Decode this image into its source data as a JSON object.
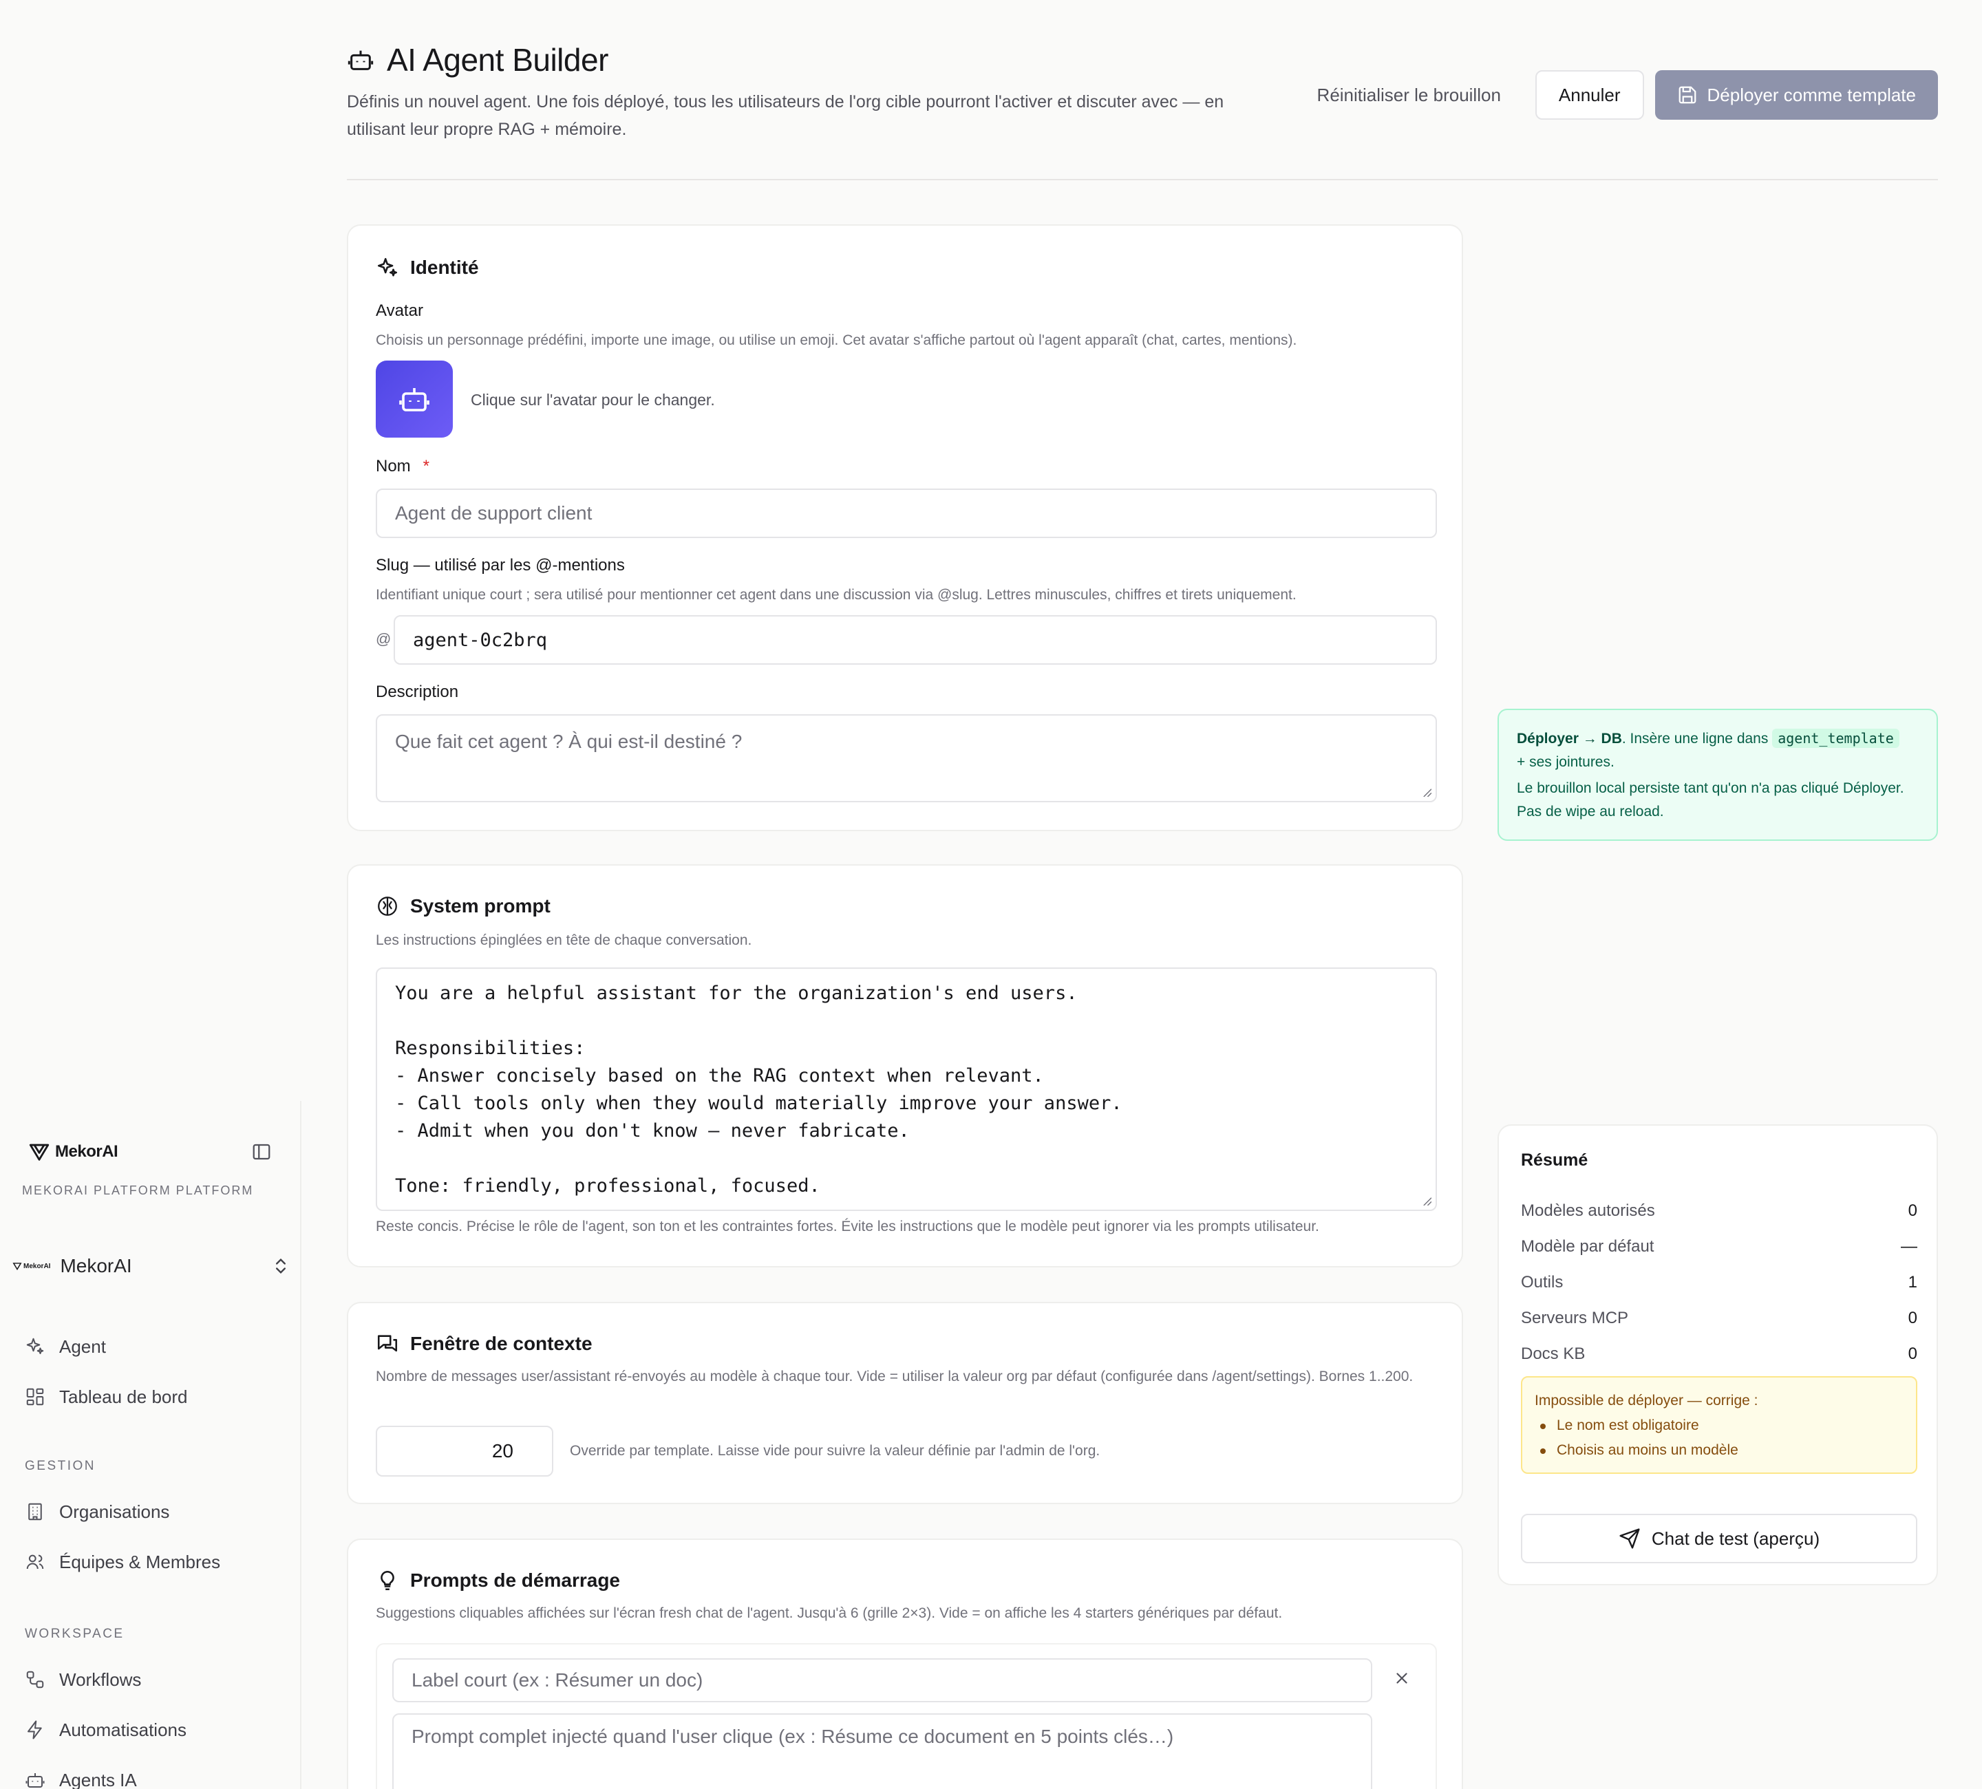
{
  "sidebar": {
    "brand": "MekorAI",
    "platform_label": "MEKORAI PLATFORM PLATFORM",
    "org_mini": "MekorAI",
    "org_name": "MekorAI",
    "nav_top": [
      {
        "label": "Agent",
        "icon": "sparkles-icon"
      },
      {
        "label": "Tableau de bord",
        "icon": "dashboard-icon"
      }
    ],
    "section_gestion": "GESTION",
    "nav_gestion": [
      {
        "label": "Organisations",
        "icon": "building-icon"
      },
      {
        "label": "Équipes & Membres",
        "icon": "users-icon"
      }
    ],
    "section_workspace": "WORKSPACE",
    "nav_workspace": [
      {
        "label": "Workflows",
        "icon": "workflow-icon"
      },
      {
        "label": "Automatisations",
        "icon": "bolt-icon"
      },
      {
        "label": "Agents IA",
        "icon": "bot-icon"
      }
    ]
  },
  "header": {
    "title": "AI Agent Builder",
    "subtitle": "Définis un nouvel agent. Une fois déployé, tous les utilisateurs de l'org cible pourront l'activer et discuter avec — en utilisant leur propre RAG + mémoire.",
    "reset_label": "Réinitialiser le brouillon",
    "cancel_label": "Annuler",
    "deploy_label": "Déployer comme template"
  },
  "identity": {
    "title": "Identité",
    "avatar_label": "Avatar",
    "avatar_help": "Choisis un personnage prédéfini, importe une image, ou utilise un emoji. Cet avatar s'affiche partout où l'agent apparaît (chat, cartes, mentions).",
    "avatar_hint": "Clique sur l'avatar pour le changer.",
    "name_label": "Nom",
    "name_required": "*",
    "name_placeholder": "Agent de support client",
    "slug_label": "Slug — utilisé par les @-mentions",
    "slug_help": "Identifiant unique court ; sera utilisé pour mentionner cet agent dans une discussion via @slug. Lettres minuscules, chiffres et tirets uniquement.",
    "slug_prefix": "@",
    "slug_value": "agent-0c2brq",
    "description_label": "Description",
    "description_placeholder": "Que fait cet agent ? À qui est-il destiné ?"
  },
  "system_prompt": {
    "title": "System prompt",
    "help": "Les instructions épinglées en tête de chaque conversation.",
    "value": "You are a helpful assistant for the organization's end users.\n\nResponsibilities:\n- Answer concisely based on the RAG context when relevant.\n- Call tools only when they would materially improve your answer.\n- Admit when you don't know — never fabricate.\n\nTone: friendly, professional, focused.",
    "footer_help": "Reste concis. Précise le rôle de l'agent, son ton et les contraintes fortes. Évite les instructions que le modèle peut ignorer via les prompts utilisateur."
  },
  "context_window": {
    "title": "Fenêtre de contexte",
    "help": "Nombre de messages user/assistant ré-envoyés au modèle à chaque tour. Vide = utiliser la valeur org par défaut (configurée dans /agent/settings). Bornes 1..200.",
    "value": "20",
    "override_help": "Override par template. Laisse vide pour suivre la valeur définie par l'admin de l'org."
  },
  "starters": {
    "title": "Prompts de démarrage",
    "help": "Suggestions cliquables affichées sur l'écran fresh chat de l'agent. Jusqu'à 6 (grille 2×3). Vide = on affiche les 4 starters génériques par défaut.",
    "label_placeholder": "Label court (ex : Résumer un doc)",
    "prompt_placeholder": "Prompt complet injecté quand l'user clique (ex : Résume ce document en 5 points clés…)"
  },
  "info": {
    "strong": "Déployer → DB",
    "text1": ". Insère une ligne dans ",
    "code": "agent_template",
    "text2": " + ses jointures.",
    "text3": "Le brouillon local persiste tant qu'on n'a pas cliqué Déployer. Pas de wipe au reload."
  },
  "summary": {
    "title": "Résumé",
    "rows": [
      {
        "label": "Modèles autorisés",
        "value": "0"
      },
      {
        "label": "Modèle par défaut",
        "value": "—"
      },
      {
        "label": "Outils",
        "value": "1"
      },
      {
        "label": "Serveurs MCP",
        "value": "0"
      },
      {
        "label": "Docs KB",
        "value": "0"
      }
    ],
    "warn_title": "Impossible de déployer — corrige :",
    "warn_items": [
      "Le nom est obligatoire",
      "Choisis au moins un modèle"
    ],
    "chat_label": "Chat de test (aperçu)"
  },
  "colors": {
    "primary_disabled": "#8e93ab",
    "avatar_start": "#4f46e5",
    "info_bg": "#ecfdf5",
    "warn_bg": "#fefce8",
    "required": "#dc2626"
  }
}
